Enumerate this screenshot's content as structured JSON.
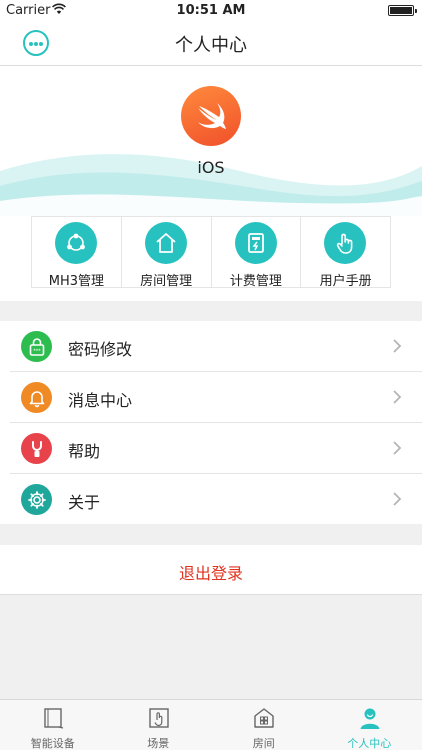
{
  "status_bar": {
    "carrier": "Carrier",
    "time": "10:51 AM"
  },
  "nav": {
    "title": "个人中心",
    "more_icon": "more-dots-icon"
  },
  "profile": {
    "name": "iOS",
    "avatar_icon": "swift-logo-icon"
  },
  "shortcuts": [
    {
      "label": "MH3管理",
      "icon": "network-nodes-icon"
    },
    {
      "label": "房间管理",
      "icon": "house-icon"
    },
    {
      "label": "计费管理",
      "icon": "meter-icon"
    },
    {
      "label": "用户手册",
      "icon": "hand-pointer-icon"
    }
  ],
  "menu": [
    {
      "label": "密码修改",
      "icon": "lock-icon",
      "color": "#2dbd4f"
    },
    {
      "label": "消息中心",
      "icon": "bell-icon",
      "color": "#f08a24"
    },
    {
      "label": "帮助",
      "icon": "wrench-icon",
      "color": "#e8434a"
    },
    {
      "label": "关于",
      "icon": "gear-icon",
      "color": "#1ea79a"
    }
  ],
  "logout": {
    "label": "退出登录"
  },
  "tabs": [
    {
      "label": "智能设备",
      "icon": "device-icon",
      "active": false
    },
    {
      "label": "场景",
      "icon": "scene-touch-icon",
      "active": false
    },
    {
      "label": "房间",
      "icon": "room-grid-icon",
      "active": false
    },
    {
      "label": "个人中心",
      "icon": "person-icon",
      "active": true
    }
  ],
  "colors": {
    "accent": "#27c2c0",
    "logout_red": "#e0331f",
    "avatar_orange": "#f26a30"
  }
}
